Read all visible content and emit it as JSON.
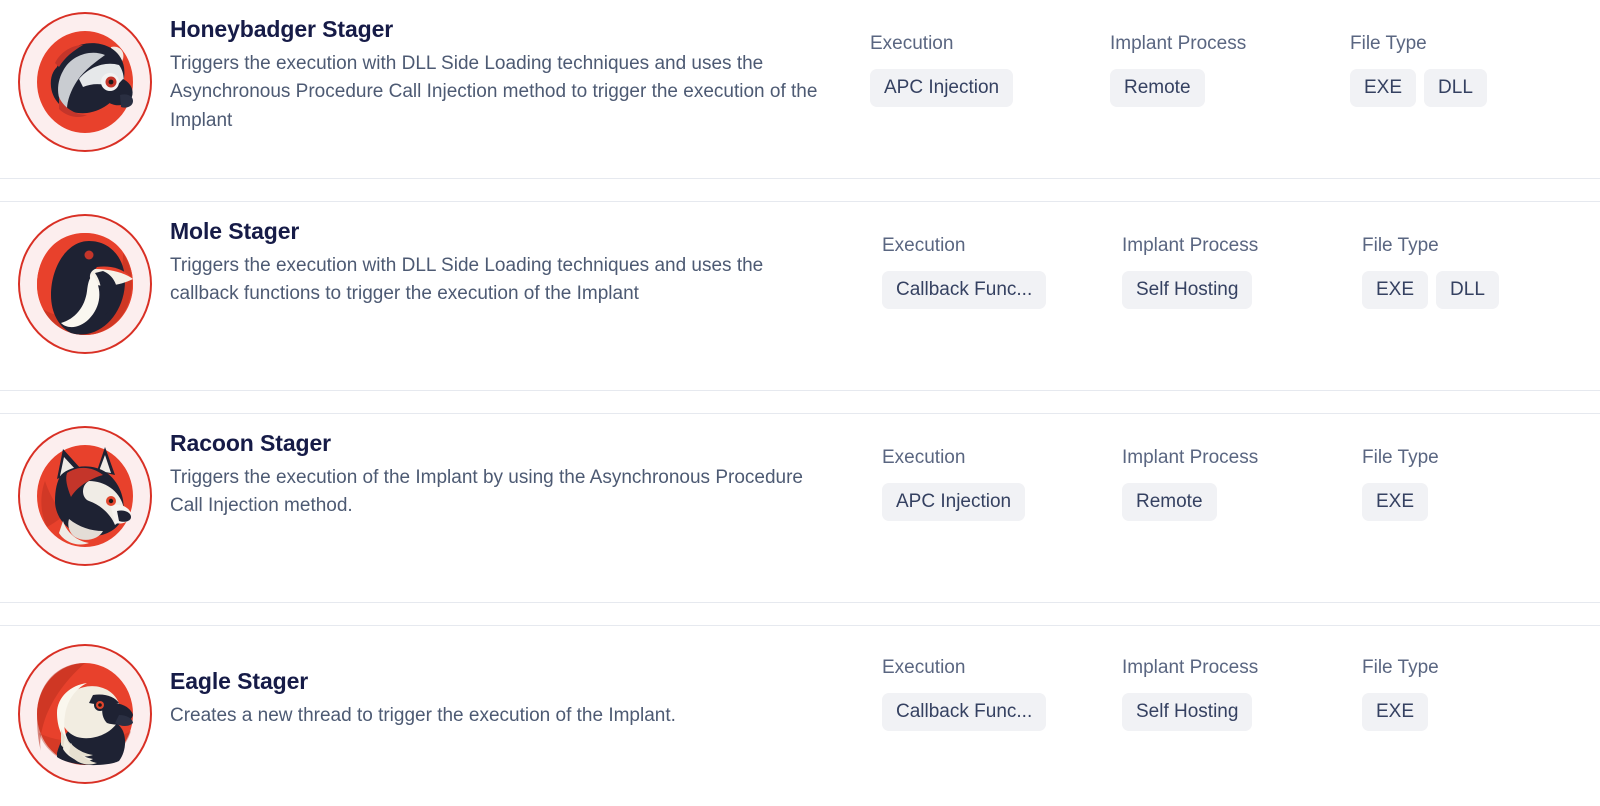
{
  "columns": {
    "execution": "Execution",
    "implant_process": "Implant Process",
    "file_type": "File Type"
  },
  "colors": {
    "accent_red": "#d93025",
    "avatar_ring": "#fceeee",
    "avatar_inner": "#e8412c",
    "title_text": "#161b47",
    "body_text": "#4d5a73",
    "label_text": "#5a6681",
    "chip_bg": "#f1f2f5",
    "chip_text": "#354161",
    "divider": "#e6e9ef"
  },
  "stagers": [
    {
      "icon": "honeybadger-avatar-icon",
      "name": "Honeybadger Stager",
      "description": "Triggers the execution with DLL Side Loading techniques and uses the Asynchronous Procedure Call Injection method to trigger the execution of the Implant",
      "execution": [
        "APC Injection"
      ],
      "implant_process": [
        "Remote"
      ],
      "file_type": [
        "EXE",
        "DLL"
      ]
    },
    {
      "icon": "mole-avatar-icon",
      "name": "Mole Stager",
      "description": "Triggers the execution with DLL Side Loading techniques and uses the callback functions to trigger the execution of the Implant",
      "execution": [
        "Callback Func..."
      ],
      "implant_process": [
        "Self Hosting"
      ],
      "file_type": [
        "EXE",
        "DLL"
      ]
    },
    {
      "icon": "racoon-avatar-icon",
      "name": "Racoon Stager",
      "description": "Triggers the execution of the Implant by using the Asynchronous Procedure Call Injection method.",
      "execution": [
        "APC Injection"
      ],
      "implant_process": [
        "Remote"
      ],
      "file_type": [
        "EXE"
      ]
    },
    {
      "icon": "eagle-avatar-icon",
      "name": "Eagle Stager",
      "description": "Creates a new thread to trigger the execution of the Implant.",
      "execution": [
        "Callback Func..."
      ],
      "implant_process": [
        "Self Hosting"
      ],
      "file_type": [
        "EXE"
      ]
    }
  ]
}
